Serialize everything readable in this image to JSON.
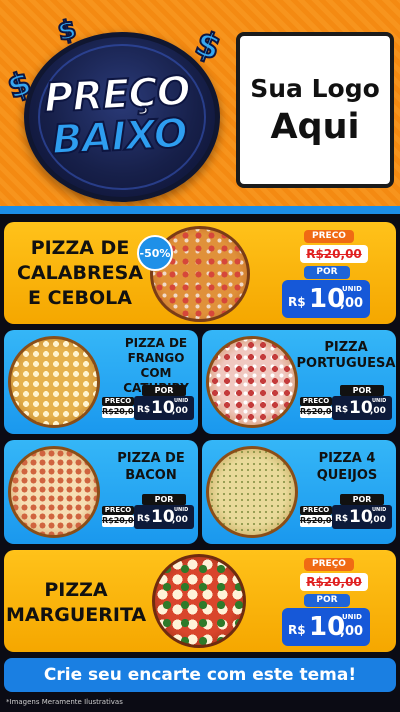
{
  "badge": {
    "line1": "PREÇO",
    "line2": "BAIXO",
    "dollar_sign": "$"
  },
  "logo": {
    "line1": "Sua Logo",
    "line2": "Aqui"
  },
  "currency": "R$",
  "unit_label": "UNID",
  "colors": {
    "orange": "#f5a700",
    "blue": "#1a98ee",
    "price_blue": "#1658d8",
    "dark": "#0b0b14",
    "banner": "#1a7fe2"
  },
  "products": {
    "calabresa": {
      "title_l1": "PIZZA DE",
      "title_l2": "CALABRESA",
      "title_l3": "E CEBOLA",
      "discount": "-50%",
      "preco_label": "PRECO",
      "old_price": "R$20,00",
      "por_label": "POR",
      "price_int": "10",
      "price_cents": ",00"
    },
    "frango": {
      "title_l1": "PIZZA DE",
      "title_l2": "FRANGO COM",
      "title_l3": "CATUPIRY",
      "preco_label": "PRECO",
      "old_price": "R$20,00",
      "por_label": "POR",
      "price_int": "10",
      "price_cents": ",00"
    },
    "portuguesa": {
      "title_l1": "PIZZA",
      "title_l2": "PORTUGUESA",
      "preco_label": "PRECO",
      "old_price": "R$20,00",
      "por_label": "POR",
      "price_int": "10",
      "price_cents": ",00"
    },
    "bacon": {
      "title_l1": "PIZZA DE",
      "title_l2": "BACON",
      "preco_label": "PRECO",
      "old_price": "R$20,00",
      "por_label": "POR",
      "price_int": "10",
      "price_cents": ",00"
    },
    "queijos": {
      "title_l1": "PIZZA 4",
      "title_l2": "QUEIJOS",
      "preco_label": "PRECO",
      "old_price": "R$20,00",
      "por_label": "POR",
      "price_int": "10",
      "price_cents": ",00"
    },
    "marguerita": {
      "title_l1": "PIZZA",
      "title_l2": "MARGUERITA",
      "preco_label": "PREÇO",
      "old_price": "R$20,00",
      "por_label": "POR",
      "price_int": "10",
      "price_cents": ",00"
    }
  },
  "banner": {
    "text": "Crie seu encarte com este tema!"
  },
  "footnote": "*Imagens Meramente Ilustrativas"
}
